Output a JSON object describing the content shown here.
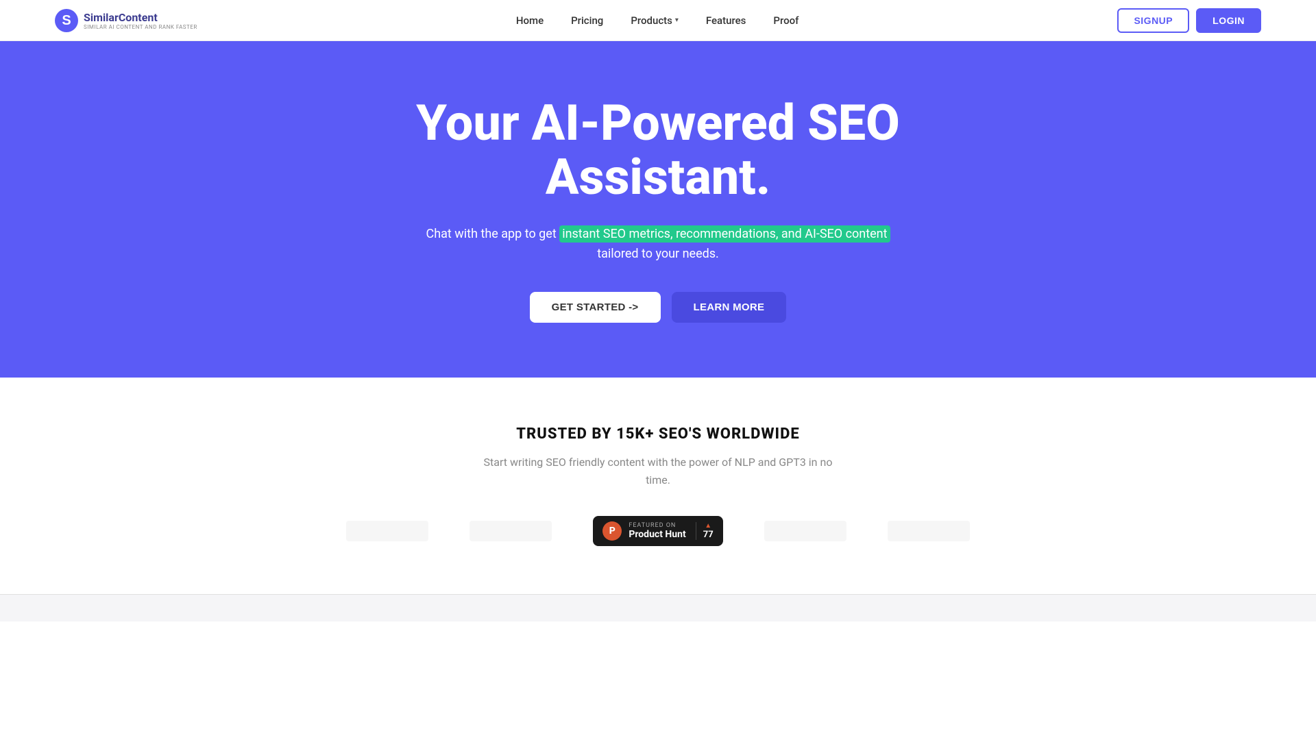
{
  "navbar": {
    "brand": "SimilarContent",
    "tagline": "SIMILAR AI CONTENT AND RANK FASTER",
    "links": [
      {
        "label": "Home",
        "id": "home"
      },
      {
        "label": "Pricing",
        "id": "pricing"
      },
      {
        "label": "Products",
        "id": "products",
        "hasDropdown": true
      },
      {
        "label": "Features",
        "id": "features"
      },
      {
        "label": "Proof",
        "id": "proof"
      }
    ],
    "signup_label": "SIGNUP",
    "login_label": "LOGIN"
  },
  "hero": {
    "title": "Your AI-Powered SEO Assistant.",
    "subtitle_before": "Chat with the app to get ",
    "subtitle_highlight": "instant SEO metrics, recommendations, and AI-SEO content",
    "subtitle_after": " tailored to your needs.",
    "cta_primary": "GET STARTED ->",
    "cta_secondary": "LEARN MORE"
  },
  "trusted": {
    "title": "TRUSTED BY 15K+ SEO'S WORLDWIDE",
    "subtitle": "Start writing SEO friendly content with the power of NLP and GPT3 in no time.",
    "product_hunt": {
      "featured_label": "FEATURED ON",
      "name": "Product Hunt",
      "upvote_count": "77"
    }
  },
  "colors": {
    "brand_blue": "#5b5bf6",
    "highlight_green": "#22c98c",
    "ph_orange": "#da552f"
  }
}
